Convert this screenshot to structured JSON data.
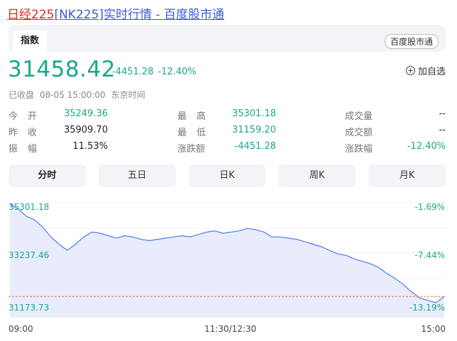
{
  "header": {
    "title_red": "日经225",
    "title_blue": "[NK225]实时行情 - 百度股市通"
  },
  "tabbar": {
    "active_tab": "指数",
    "source_badge": "百度股市通"
  },
  "quote": {
    "price": "31458.42",
    "change": "-4451.28",
    "change_pct": "-12.40%",
    "add_favorite": "加自选",
    "status": "已收盘",
    "datetime": "08-05 15:00:00",
    "timezone": "东京时间"
  },
  "stats": {
    "open_label": "今开",
    "open_value": "35249.36",
    "prev_close_label": "昨收",
    "prev_close_value": "35909.70",
    "amplitude_label": "振幅",
    "amplitude_value": "11.53%",
    "high_label": "最高",
    "high_value": "35301.18",
    "low_label": "最低",
    "low_value": "31159.20",
    "change_amt_label": "涨跌额",
    "change_amt_value": "-4451.28",
    "volume_label": "成交量",
    "volume_value": "--",
    "turnover_label": "成交额",
    "turnover_value": "--",
    "change_pct_label": "涨跌幅",
    "change_pct_value": "-12.40%"
  },
  "period_tabs": [
    "分时",
    "五日",
    "日K",
    "周K",
    "月K"
  ],
  "chart_labels": {
    "y_left": [
      "35301.18",
      "33237.46",
      "31173.73"
    ],
    "y_right": [
      "-1.69%",
      "-7.44%",
      "-13.19%"
    ],
    "x": [
      "09:00",
      "11:30/12:30",
      "15:00"
    ]
  },
  "colors": {
    "up_down_green": "#19a88c",
    "line_blue": "#4f7be8",
    "area_fill": "#e8ecfb",
    "ref_line": "#e8743a"
  },
  "chart_data": {
    "type": "area",
    "ylim": [
      31173.73,
      35301.18
    ],
    "y_right_pct": [
      -1.69,
      -7.44,
      -13.19
    ],
    "x_ticks": [
      "09:00",
      "11:30/12:30",
      "15:00"
    ],
    "series": [
      {
        "values": [
          35250,
          35050,
          34750,
          34600,
          34300,
          33900,
          33600,
          33350,
          33600,
          33900,
          34100,
          34050,
          33950,
          33850,
          33950,
          33900,
          33800,
          33750,
          33800,
          33850,
          33900,
          33950,
          33900,
          34000,
          34100,
          34150,
          34050,
          34100,
          34150,
          34250,
          34200,
          34100,
          33900,
          33900,
          33850,
          33800,
          33700,
          33600,
          33500,
          33350,
          33200,
          33150,
          33000,
          32900,
          32800,
          32650,
          32400,
          32200,
          31950,
          31650,
          31400,
          31300,
          31200,
          31458
        ]
      }
    ]
  }
}
